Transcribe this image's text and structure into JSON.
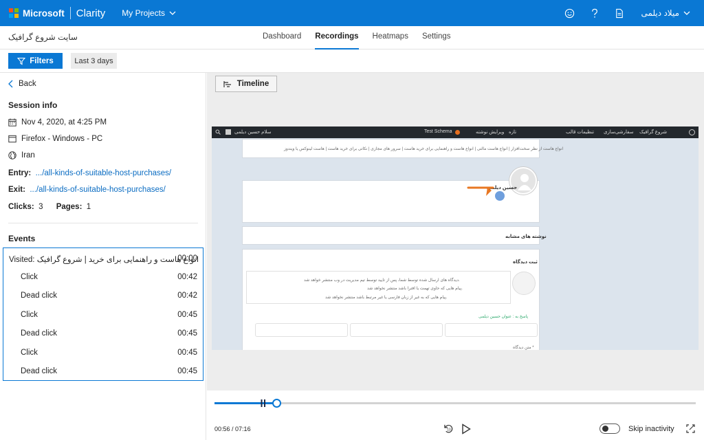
{
  "topbar": {
    "brand": "Microsoft",
    "product": "Clarity",
    "projects_label": "My Projects",
    "user_name": "میلاد دیلمی"
  },
  "subbar": {
    "site_name": "سایت شروع گرافیک",
    "tabs": [
      {
        "label": "Dashboard",
        "active": false
      },
      {
        "label": "Recordings",
        "active": true
      },
      {
        "label": "Heatmaps",
        "active": false
      },
      {
        "label": "Settings",
        "active": false
      }
    ]
  },
  "filters": {
    "filters_label": "Filters",
    "range_label": "Last 3 days"
  },
  "session": {
    "back_label": "Back",
    "heading": "Session info",
    "date": "Nov 4, 2020, at 4:25 PM",
    "device": "Firefox - Windows - PC",
    "country": "Iran",
    "entry_label": "Entry:",
    "entry_url": ".../all-kinds-of-suitable-host-purchases/",
    "exit_label": "Exit:",
    "exit_url": ".../all-kinds-of-suitable-host-purchases/",
    "clicks_label": "Clicks:",
    "clicks": "3",
    "pages_label": "Pages:",
    "pages": "1"
  },
  "events": {
    "heading": "Events",
    "items": [
      {
        "label": "Visited: انواع هاست و راهنمایی برای خرید | شروع گرافیک",
        "time": "00:00"
      },
      {
        "label": "Click",
        "time": "00:42"
      },
      {
        "label": "Dead click",
        "time": "00:42"
      },
      {
        "label": "Click",
        "time": "00:45"
      },
      {
        "label": "Dead click",
        "time": "00:45"
      },
      {
        "label": "Click",
        "time": "00:45"
      },
      {
        "label": "Dead click",
        "time": "00:45"
      }
    ]
  },
  "viewer": {
    "timeline_label": "Timeline",
    "recording": {
      "admin_user": "سلام حسین دیلمی",
      "admin_schema": "Test Schema",
      "admin_site": "شروع گرافیک",
      "admin_customize": "سفارشی‌سازی",
      "admin_theme": "تنظیمات قالب",
      "admin_new": "تازه",
      "admin_edit": "ویرایش نوشته",
      "nav_links": "انواع هاست از نظر سخت‌افزار  |  انواع هاست مالتی  |  انواع هاست و راهنمایی برای خرید هاست  |  سرور های مجازی  |  نکاتی برای خرید هاست  |  هاست لینوکس یا ویندوز",
      "author_name": "حسین دیلمی",
      "related_heading": "نوشته های مشابه",
      "comment_heading": "ثبت دیدگاه",
      "note_1": "دیدگاه های ارسال شده توسط شما، پس از تایید توسط تیم مدیریت در وب منتشر خواهد شد.",
      "note_2": "پیام هایی که حاوی تهمت یا افترا باشد منتشر نخواهد شد.",
      "note_3": "پیام هایی که به غیر از زبان فارسی یا غیر مرتبط باشد منتشر نخواهد شد.",
      "reply_to": "پاسخ به : عنوان حسین دیلمی",
      "field_hint": "متن دیدگاه *"
    }
  },
  "player": {
    "current": "00:56",
    "total": "07:16",
    "progress_fraction": 0.129,
    "skip_label": "Skip inactivity",
    "skip_enabled": false
  },
  "colors": {
    "brand_blue": "#0a78d4",
    "wp_bar": "#23282d",
    "click_marker": "#e87722"
  }
}
